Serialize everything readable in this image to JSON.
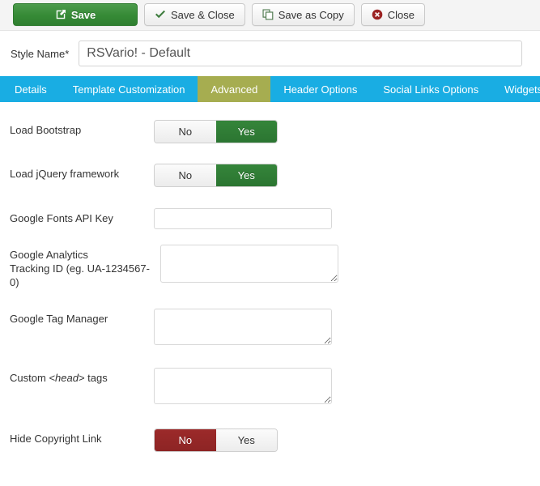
{
  "toolbar": {
    "buttons": [
      {
        "label": "Save",
        "icon": "edit-square-icon",
        "style": "primary"
      },
      {
        "label": "Save & Close",
        "icon": "check-icon",
        "style": "default"
      },
      {
        "label": "Save as Copy",
        "icon": "copy-icon",
        "style": "default"
      },
      {
        "label": "Close",
        "icon": "cancel-circle-icon",
        "style": "default"
      }
    ]
  },
  "style_name": {
    "label": "Style Name",
    "required_marker": "*",
    "value": "RSVario! - Default",
    "placeholder": ""
  },
  "tabs": [
    {
      "label": "Details",
      "active": false
    },
    {
      "label": "Template Customization",
      "active": false
    },
    {
      "label": "Advanced",
      "active": true
    },
    {
      "label": "Header Options",
      "active": false
    },
    {
      "label": "Social Links Options",
      "active": false
    },
    {
      "label": "Widgets",
      "active": false
    }
  ],
  "fields": {
    "load_bootstrap": {
      "label": "Load Bootstrap",
      "options": {
        "no": "No",
        "yes": "Yes"
      },
      "selected": "yes"
    },
    "load_jquery": {
      "label": "Load jQuery framework",
      "options": {
        "no": "No",
        "yes": "Yes"
      },
      "selected": "yes"
    },
    "google_fonts_api_key": {
      "label": "Google Fonts API Key",
      "value": "",
      "placeholder": ""
    },
    "google_analytics": {
      "label_line1": "Google Analytics",
      "label_line2": "Tracking ID (eg. UA-1234567-0)",
      "value": "",
      "placeholder": ""
    },
    "google_tag_manager": {
      "label": "Google Tag Manager",
      "value": "",
      "placeholder": ""
    },
    "custom_head_tags": {
      "label_before": "Custom ",
      "label_em": "<head>",
      "label_after": " tags",
      "value": "",
      "placeholder": ""
    },
    "hide_copyright_link": {
      "label": "Hide Copyright Link",
      "options": {
        "no": "No",
        "yes": "Yes"
      },
      "selected": "no"
    }
  },
  "colors": {
    "tab_bar": "#19ade3",
    "tab_active": "#a6ad50",
    "toggle_on_green": "#2f7f35",
    "toggle_on_red": "#9c2a2a",
    "save_button_green": "#368a36",
    "toolbar_bg": "#f4f4f4"
  }
}
